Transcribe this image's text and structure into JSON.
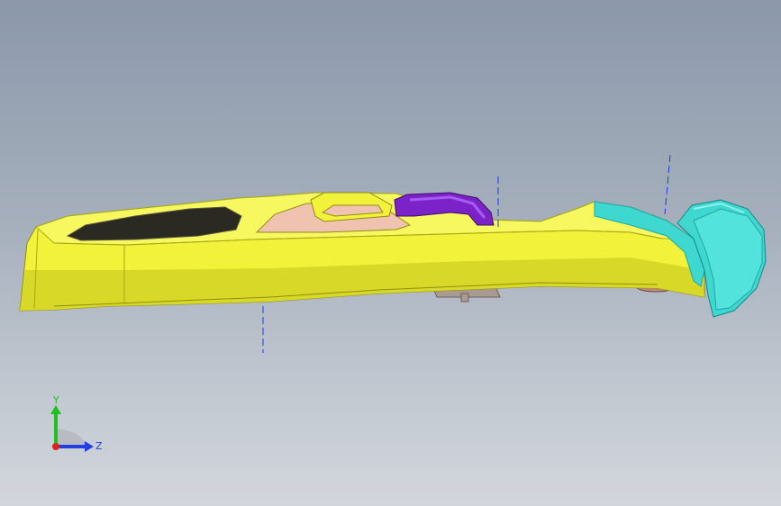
{
  "viewport": {
    "background_top": "#8b98aa",
    "background_bottom": "#d2d6dc"
  },
  "model": {
    "colors": {
      "body": "#f2f23a",
      "body_dark": "#c9c91a",
      "body_edge": "#8f8f10",
      "grille": "#2b2a22",
      "interior": "#f0c2b0",
      "duct": "#7b22c9",
      "duct_light": "#a65cf0",
      "end_cap": "#3fd8d0",
      "end_cap_dark": "#1fa7a2",
      "end_cap_light": "#8ff2ee",
      "underside": "#a99a92",
      "centerline": "#1f3de0"
    }
  },
  "triad": {
    "y_label": "Y",
    "z_label": "Z",
    "y_color": "#20c020",
    "z_color": "#2040e0",
    "x_color": "#e02020"
  }
}
